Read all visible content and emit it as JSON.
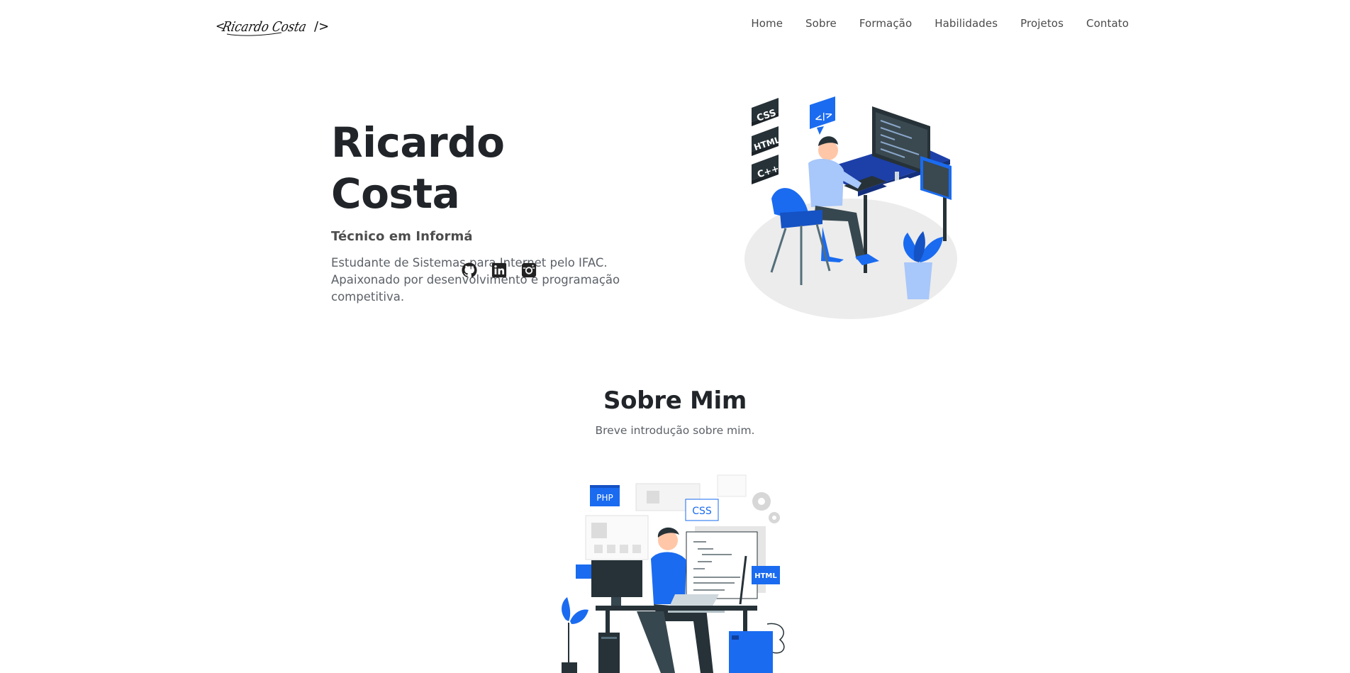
{
  "brand": {
    "logo_text": "Ricardo Costa",
    "logo_prefix": "<",
    "logo_suffix": "/>"
  },
  "nav": {
    "items": [
      {
        "label": "Home"
      },
      {
        "label": "Sobre"
      },
      {
        "label": "Formação"
      },
      {
        "label": "Habilidades"
      },
      {
        "label": "Projetos"
      },
      {
        "label": "Contato"
      }
    ]
  },
  "hero": {
    "name": "Ricardo Costa",
    "subtitle": "Técnico em Informá",
    "description": "Estudante de Sistemas para Internet pelo IFAC. Apaixonado por desenvolvimento e programação competitiva.",
    "socials": [
      {
        "icon": "github-icon"
      },
      {
        "icon": "linkedin-icon"
      },
      {
        "icon": "instagram-icon"
      }
    ],
    "illustration_labels": [
      "CSS",
      "HTML",
      "C++",
      "</>"
    ]
  },
  "about": {
    "title": "Sobre Mim",
    "subtitle": "Breve introdução sobre mim.",
    "illustration_labels": [
      "PHP",
      "CSS",
      "HTML"
    ]
  },
  "colors": {
    "accent": "#1a6bf0",
    "dark": "#263238",
    "text": "#212529",
    "muted": "#5c6168"
  }
}
